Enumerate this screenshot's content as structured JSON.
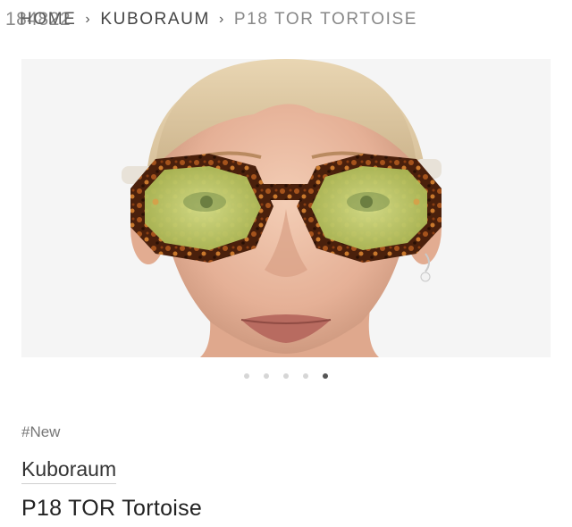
{
  "overlay_id": "184822",
  "breadcrumb": {
    "home": "HOME",
    "brand": "KUBORAUM",
    "current": "P18 TOR TORTOISE",
    "separator": "›"
  },
  "gallery": {
    "dot_count": 5,
    "active_index": 4
  },
  "product": {
    "tag": "#New",
    "brand": "Kuboraum",
    "name": "P18 TOR Tortoise"
  },
  "colors": {
    "background": "#ffffff",
    "dot_active": "#555555",
    "dot_inactive": "#d6d6d6",
    "lens": "#c9d66a",
    "frame": "#5a2a12"
  }
}
